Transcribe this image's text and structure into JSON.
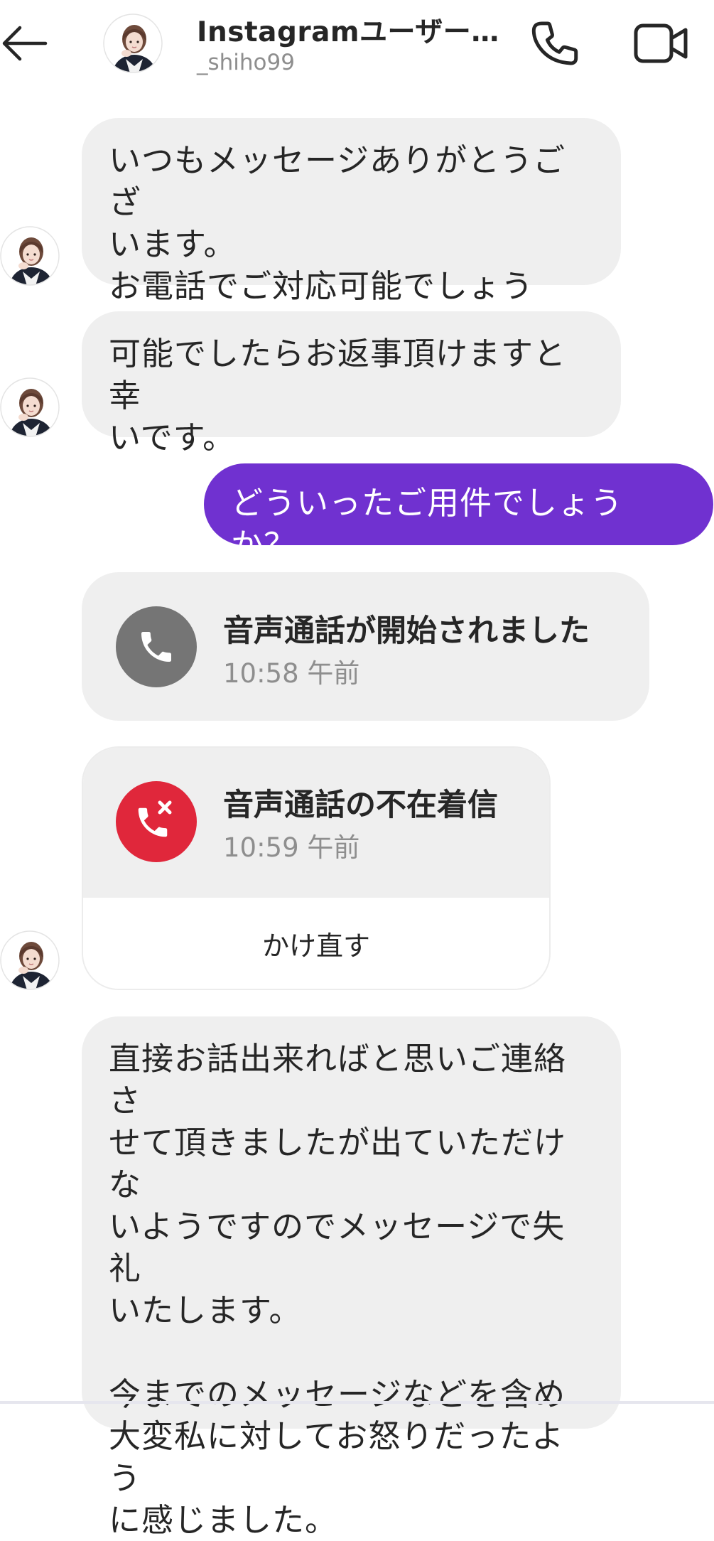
{
  "header": {
    "title": "Instagramユーザー…",
    "username": "_shiho99"
  },
  "messages": [
    {
      "sender": "them",
      "text": "いつもメッセージありがとうござ\nいます。\nお電話でご対応可能でしょうか？"
    },
    {
      "sender": "them",
      "text": "可能でしたらお返事頂けますと幸\nいです。"
    },
    {
      "sender": "me",
      "text": "どういったご用件でしょうか？"
    },
    {
      "sender": "them",
      "text": "直接お話出来ればと思いご連絡さ\nせて頂きましたが出ていただけな\nいようですのでメッセージで失礼\nいたします。\n\n今までのメッセージなどを含め\n大変私に対してお怒りだったよう\nに感じました。"
    }
  ],
  "calls": [
    {
      "title": "音声通話が開始されました",
      "time": "10:58 午前",
      "type": "started"
    },
    {
      "title": "音声通話の不在着信",
      "time": "10:59 午前",
      "type": "missed",
      "action": "かけ直す"
    }
  ],
  "colors": {
    "sent_bubble": "#7031d0",
    "received_bubble": "#efefef",
    "call_started_icon": "#757575",
    "call_missed_icon": "#e0273b"
  }
}
